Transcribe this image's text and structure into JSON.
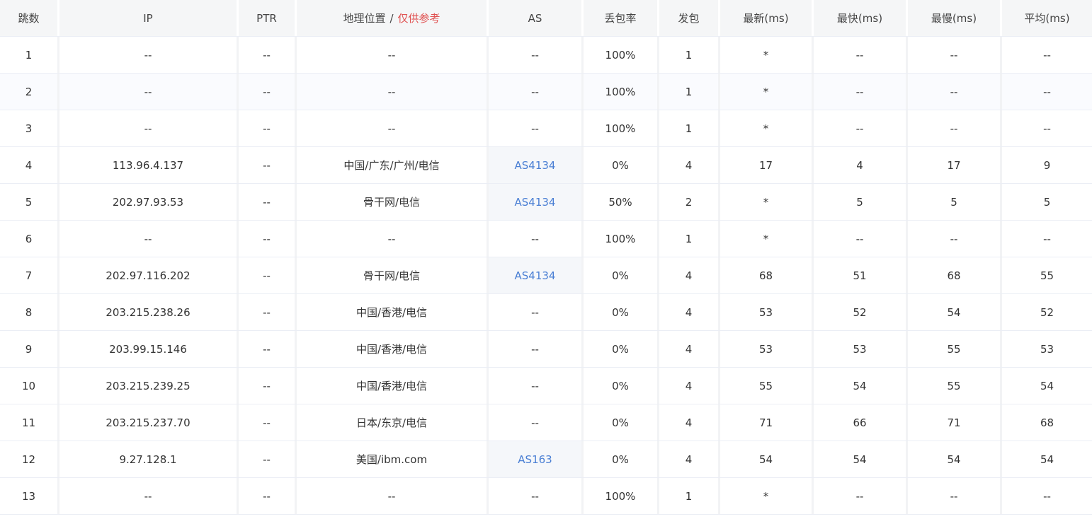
{
  "colors": {
    "as_link": "#4a7fd4",
    "geo_note": "#e05252",
    "header_bg": "#f5f6f7",
    "alt_row_bg": "#fafbfe"
  },
  "header": {
    "hop": "跳数",
    "ip": "IP",
    "ptr": "PTR",
    "geo": "地理位置",
    "geo_separator": "/",
    "geo_note": "仅供参考",
    "as": "AS",
    "loss": "丢包率",
    "sent": "发包",
    "last": "最新(ms)",
    "best": "最快(ms)",
    "worst": "最慢(ms)",
    "avg": "平均(ms)"
  },
  "rows": [
    {
      "hop": "1",
      "ip": "--",
      "ptr": "--",
      "geo": "--",
      "as": "--",
      "as_link": false,
      "loss": "100%",
      "sent": "1",
      "last": "*",
      "best": "--",
      "worst": "--",
      "avg": "--"
    },
    {
      "hop": "2",
      "ip": "--",
      "ptr": "--",
      "geo": "--",
      "as": "--",
      "as_link": false,
      "loss": "100%",
      "sent": "1",
      "last": "*",
      "best": "--",
      "worst": "--",
      "avg": "--"
    },
    {
      "hop": "3",
      "ip": "--",
      "ptr": "--",
      "geo": "--",
      "as": "--",
      "as_link": false,
      "loss": "100%",
      "sent": "1",
      "last": "*",
      "best": "--",
      "worst": "--",
      "avg": "--"
    },
    {
      "hop": "4",
      "ip": "113.96.4.137",
      "ptr": "--",
      "geo": "中国/广东/广州/电信",
      "as": "AS4134",
      "as_link": true,
      "loss": "0%",
      "sent": "4",
      "last": "17",
      "best": "4",
      "worst": "17",
      "avg": "9"
    },
    {
      "hop": "5",
      "ip": "202.97.93.53",
      "ptr": "--",
      "geo": "骨干网/电信",
      "as": "AS4134",
      "as_link": true,
      "loss": "50%",
      "sent": "2",
      "last": "*",
      "best": "5",
      "worst": "5",
      "avg": "5"
    },
    {
      "hop": "6",
      "ip": "--",
      "ptr": "--",
      "geo": "--",
      "as": "--",
      "as_link": false,
      "loss": "100%",
      "sent": "1",
      "last": "*",
      "best": "--",
      "worst": "--",
      "avg": "--"
    },
    {
      "hop": "7",
      "ip": "202.97.116.202",
      "ptr": "--",
      "geo": "骨干网/电信",
      "as": "AS4134",
      "as_link": true,
      "loss": "0%",
      "sent": "4",
      "last": "68",
      "best": "51",
      "worst": "68",
      "avg": "55"
    },
    {
      "hop": "8",
      "ip": "203.215.238.26",
      "ptr": "--",
      "geo": "中国/香港/电信",
      "as": "--",
      "as_link": false,
      "loss": "0%",
      "sent": "4",
      "last": "53",
      "best": "52",
      "worst": "54",
      "avg": "52"
    },
    {
      "hop": "9",
      "ip": "203.99.15.146",
      "ptr": "--",
      "geo": "中国/香港/电信",
      "as": "--",
      "as_link": false,
      "loss": "0%",
      "sent": "4",
      "last": "53",
      "best": "53",
      "worst": "55",
      "avg": "53"
    },
    {
      "hop": "10",
      "ip": "203.215.239.25",
      "ptr": "--",
      "geo": "中国/香港/电信",
      "as": "--",
      "as_link": false,
      "loss": "0%",
      "sent": "4",
      "last": "55",
      "best": "54",
      "worst": "55",
      "avg": "54"
    },
    {
      "hop": "11",
      "ip": "203.215.237.70",
      "ptr": "--",
      "geo": "日本/东京/电信",
      "as": "--",
      "as_link": false,
      "loss": "0%",
      "sent": "4",
      "last": "71",
      "best": "66",
      "worst": "71",
      "avg": "68"
    },
    {
      "hop": "12",
      "ip": "9.27.128.1",
      "ptr": "--",
      "geo": "美国/ibm.com",
      "as": "AS163",
      "as_link": true,
      "loss": "0%",
      "sent": "4",
      "last": "54",
      "best": "54",
      "worst": "54",
      "avg": "54"
    },
    {
      "hop": "13",
      "ip": "--",
      "ptr": "--",
      "geo": "--",
      "as": "--",
      "as_link": false,
      "loss": "100%",
      "sent": "1",
      "last": "*",
      "best": "--",
      "worst": "--",
      "avg": "--"
    }
  ]
}
